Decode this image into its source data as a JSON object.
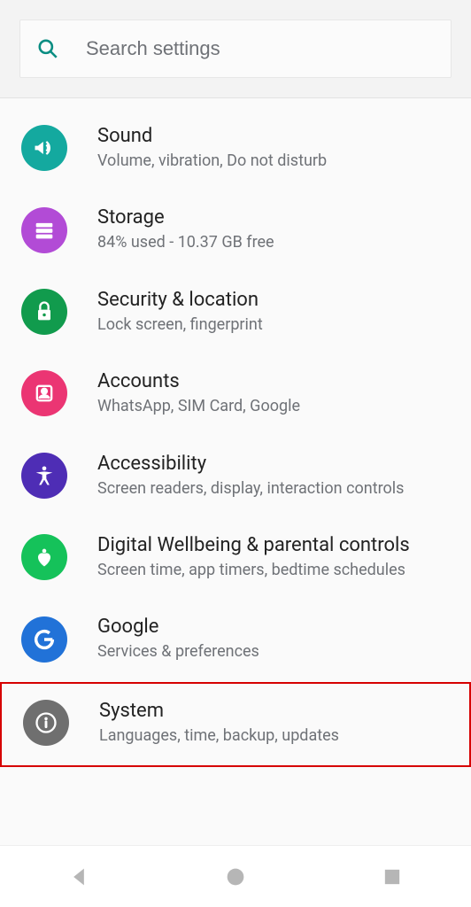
{
  "search": {
    "placeholder": "Search settings"
  },
  "items": [
    {
      "title": "Sound",
      "subtitle": "Volume, vibration, Do not disturb",
      "color": "#14a99f"
    },
    {
      "title": "Storage",
      "subtitle": "84% used - 10.37 GB free",
      "color": "#b24bd6"
    },
    {
      "title": "Security & location",
      "subtitle": "Lock screen, fingerprint",
      "color": "#119b4d"
    },
    {
      "title": "Accounts",
      "subtitle": "WhatsApp, SIM Card, Google",
      "color": "#eb3573"
    },
    {
      "title": "Accessibility",
      "subtitle": "Screen readers, display, interaction controls",
      "color": "#4e2db5"
    },
    {
      "title": "Digital Wellbeing & parental controls",
      "subtitle": "Screen time, app timers, bedtime schedules",
      "color": "#15c25a"
    },
    {
      "title": "Google",
      "subtitle": "Services & preferences",
      "color": "#2172d8"
    },
    {
      "title": "System",
      "subtitle": "Languages, time, backup, updates",
      "color": "#6f6f6f"
    }
  ]
}
